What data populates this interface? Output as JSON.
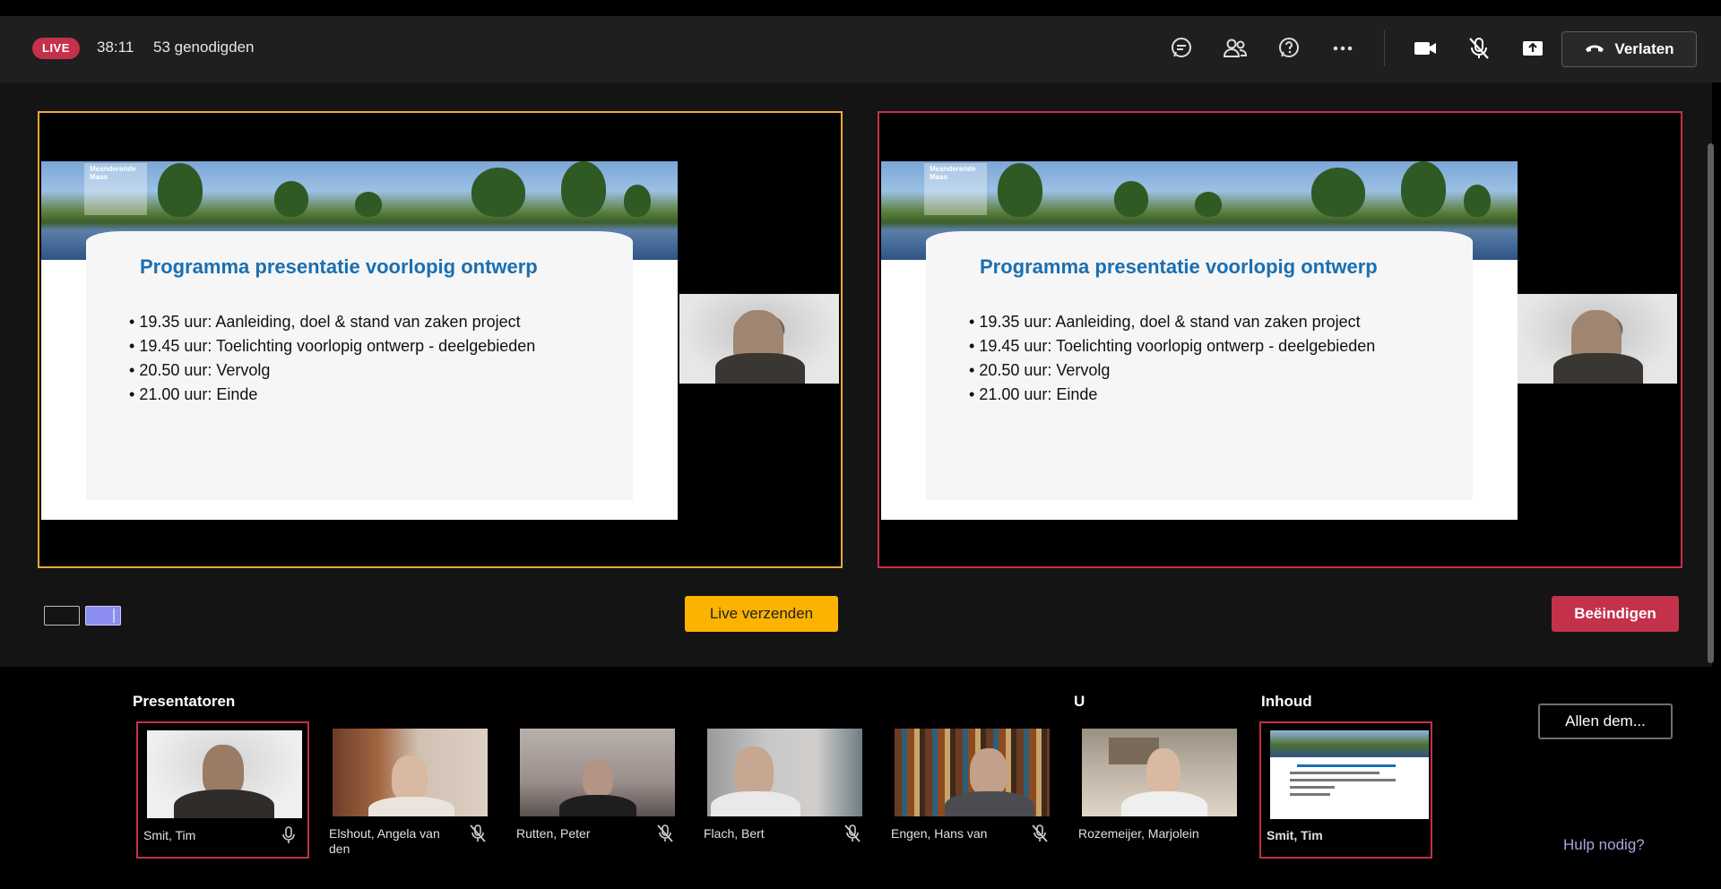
{
  "header": {
    "live_badge": "LIVE",
    "timer": "38:11",
    "guests": "53 genodigden",
    "leave_label": "Verlaten"
  },
  "toolbar_icons": [
    "chat-icon",
    "people-icon",
    "qna-icon",
    "more-icon",
    "camera-icon",
    "mic-muted-icon",
    "share-icon"
  ],
  "slide": {
    "logo_text": "Meanderende Maas",
    "title": "Programma presentatie voorlopig ontwerp",
    "items": [
      "19.35 uur: Aanleiding, doel & stand van zaken project",
      "19.45 uur: Toelichting voorlopig ontwerp - deelgebieden",
      "20.50 uur: Vervolg",
      "21.00 uur: Einde"
    ]
  },
  "controls": {
    "live_send_label": "Live verzenden",
    "end_label": "Beëindigen"
  },
  "sections": {
    "presenters": "Presentatoren",
    "you": "U",
    "content": "Inhoud"
  },
  "participants": [
    {
      "name": "Smit, Tim",
      "mic": "unmuted"
    },
    {
      "name": "Elshout, Angela van den",
      "mic": "muted"
    },
    {
      "name": "Rutten, Peter",
      "mic": "muted"
    },
    {
      "name": "Flach, Bert",
      "mic": "muted"
    },
    {
      "name": "Engen, Hans van",
      "mic": "muted"
    },
    {
      "name": "Rozemeijer, Marjolein",
      "mic": "none"
    }
  ],
  "content_tile": {
    "name": "Smit, Tim"
  },
  "side": {
    "mute_all_label": "Allen dem...",
    "help_label": "Hulp nodig?"
  },
  "colors": {
    "live_red": "#c4314b",
    "preview_border": "#f0a93b",
    "live_send_yellow": "#fbb300",
    "help_link": "#a6a7dc"
  }
}
